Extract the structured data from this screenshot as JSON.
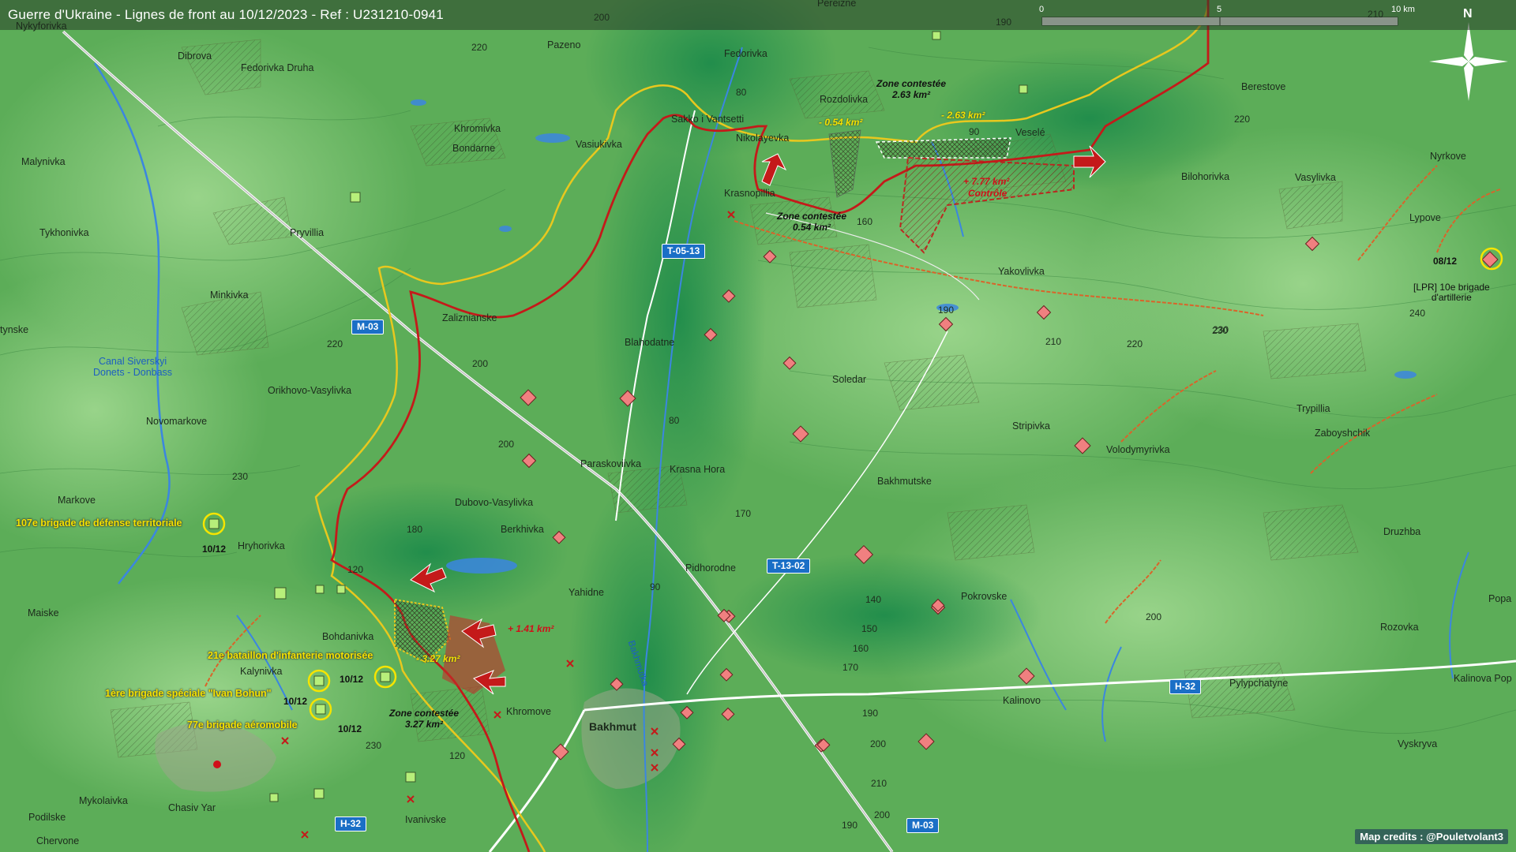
{
  "title": "Guerre d'Ukraine - Lignes de front au 10/12/2023 - Ref : U231210-0941",
  "scale": {
    "ticks": [
      "0",
      "5",
      "10 km"
    ]
  },
  "north": "N",
  "credits": "Map credits : @Pouletvolant3",
  "places": [
    {
      "name": "Pereizne"
    },
    {
      "name": "Nykyforivka"
    },
    {
      "name": "Pazeno"
    },
    {
      "name": "Dibrova"
    },
    {
      "name": "Fedorivka Druha"
    },
    {
      "name": "Fedorivka"
    },
    {
      "name": "Rozdolivka"
    },
    {
      "name": "Berestove"
    },
    {
      "name": "Sakko i Vantsetti"
    },
    {
      "name": "Nikolayevka"
    },
    {
      "name": "Khromivka"
    },
    {
      "name": "Bondarne"
    },
    {
      "name": "Vasiukivka"
    },
    {
      "name": "Veselé"
    },
    {
      "name": "Nyrkove"
    },
    {
      "name": "Malynivka"
    },
    {
      "name": "Bilohorivka"
    },
    {
      "name": "Krasnopillia"
    },
    {
      "name": "Vasylivka"
    },
    {
      "name": "Tykhonivka"
    },
    {
      "name": "Pryvillia"
    },
    {
      "name": "Lypove"
    },
    {
      "name": "Yakovlivka"
    },
    {
      "name": "Minkivka"
    },
    {
      "name": "Zaliznianske"
    },
    {
      "name": "tynske"
    },
    {
      "name": "Blahodatne"
    },
    {
      "name": "Soledar"
    },
    {
      "name": "Orikhovo-Vasylivka"
    },
    {
      "name": "Novomarkove"
    },
    {
      "name": "Stripivka"
    },
    {
      "name": "Volodymyrivka"
    },
    {
      "name": "Trypillia"
    },
    {
      "name": "Zaboyshchik"
    },
    {
      "name": "Paraskoviivka"
    },
    {
      "name": "Krasna Hora"
    },
    {
      "name": "Markove"
    },
    {
      "name": "Bakhmutske"
    },
    {
      "name": "Dubovo-Vasylivka"
    },
    {
      "name": "Berkhivka"
    },
    {
      "name": "Druzhba"
    },
    {
      "name": "Hryhorivka"
    },
    {
      "name": "Pidhorodne"
    },
    {
      "name": "Yahidne"
    },
    {
      "name": "Pokrovske"
    },
    {
      "name": "Maiske"
    },
    {
      "name": "Bohdanivka"
    },
    {
      "name": "Rozovka"
    },
    {
      "name": "Kalynivka"
    },
    {
      "name": "Pylypchatyne"
    },
    {
      "name": "Kalinovo"
    },
    {
      "name": "Kalinova Pop"
    },
    {
      "name": "Khromove"
    },
    {
      "name": "Bakhmut"
    },
    {
      "name": "Vyskryva"
    },
    {
      "name": "Mykolaivka"
    },
    {
      "name": "Chasiv Yar"
    },
    {
      "name": "Podilske"
    },
    {
      "name": "Ivanivske"
    },
    {
      "name": "Chervone"
    },
    {
      "name": "Popa"
    }
  ],
  "elevations": [
    "200",
    "220",
    "190",
    "210",
    "220",
    "80",
    "90",
    "160",
    "230",
    "190",
    "220",
    "210",
    "230",
    "240",
    "220",
    "200",
    "200",
    "80",
    "170",
    "230",
    "180",
    "120",
    "200",
    "90",
    "140",
    "150",
    "160",
    "170",
    "190",
    "120",
    "200",
    "230",
    "210",
    "200",
    "190"
  ],
  "roads": [
    "M-03",
    "T-05-13",
    "T-13-02",
    "H-32",
    "H-32",
    "M-03"
  ],
  "canal": {
    "line1": "Canal Siverskyi",
    "line2": "Donets - Donbass"
  },
  "river": "Bakhmutka",
  "zones": [
    {
      "title": "Zone contestée",
      "area": "2.63 km²"
    },
    {
      "title": "Zone contestée",
      "area": "0.54 km²"
    },
    {
      "title": "Zone contestée",
      "area": "3.27 km²"
    }
  ],
  "area_changes": [
    {
      "text": "- 0.54 km²",
      "color": "#f2e200"
    },
    {
      "text": "- 2.63 km²",
      "color": "#f2e200"
    },
    {
      "text": "+ 7.77 km²",
      "color": "#d0101a"
    },
    {
      "text": "Contrôle",
      "color": "#d0101a"
    },
    {
      "text": "+ 1.41 km²",
      "color": "#d0101a"
    },
    {
      "text": "- 3.27 km²",
      "color": "#f2e200"
    }
  ],
  "units": [
    {
      "name": "107e brigade de défense territoriale",
      "date": "10/12"
    },
    {
      "name": "21e bataillon d'infanterie motorisée",
      "date": "10/12"
    },
    {
      "name": "1ère brigade spéciale \"Ivan Bohun\"",
      "date": "10/12"
    },
    {
      "name": "77e brigade aéromobile",
      "date": "10/12"
    }
  ],
  "lpr_unit": {
    "date": "08/12",
    "line1": "[LPR] 10e brigade",
    "line2": "d'artillerie"
  },
  "colors": {
    "ua_line": "#e8c81e",
    "ru_line": "#c41a1a",
    "ru_marker": "#f08080",
    "ua_marker": "#b7ef7a",
    "road": "#1a6fc6",
    "water": "#3b86e0",
    "rail": "#d9642a"
  }
}
